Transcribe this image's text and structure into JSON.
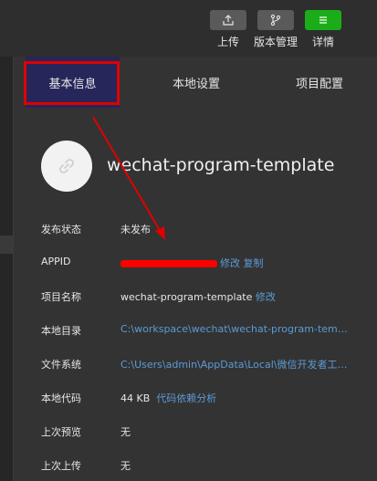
{
  "toolbar": {
    "upload_label": "上传",
    "version_label": "版本管理",
    "details_label": "详情",
    "accent_color": "#1aad19"
  },
  "tabs": [
    {
      "label": "基本信息",
      "active": true
    },
    {
      "label": "本地设置",
      "active": false
    },
    {
      "label": "项目配置",
      "active": false
    }
  ],
  "app": {
    "name": "wechat-program-template",
    "avatar_icon": "link-icon"
  },
  "info": {
    "publish_status": {
      "key": "发布状态",
      "value": "未发布"
    },
    "appid": {
      "key": "APPID",
      "modify": "修改",
      "copy": "复制"
    },
    "project_name": {
      "key": "项目名称",
      "value": "wechat-program-template",
      "modify": "修改"
    },
    "local_dir": {
      "key": "本地目录",
      "value": "C:\\workspace\\wechat\\wechat-program-template"
    },
    "file_system": {
      "key": "文件系统",
      "value": "C:\\Users\\admin\\AppData\\Local\\微信开发者工具\\U..."
    },
    "local_code": {
      "key": "本地代码",
      "value": "44 KB",
      "analysis": "代码依赖分析"
    },
    "last_preview": {
      "key": "上次预览",
      "value": "无"
    },
    "last_upload": {
      "key": "上次上传",
      "value": "无"
    }
  },
  "annotation_color": "#e00000"
}
